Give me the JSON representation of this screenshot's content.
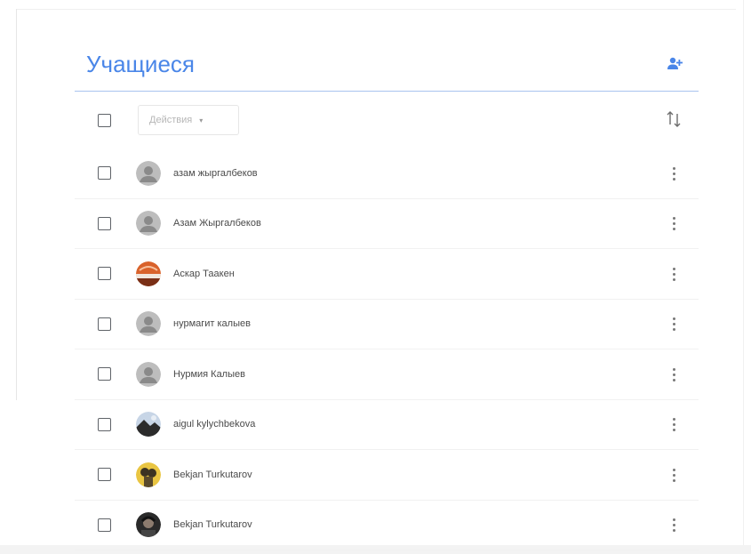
{
  "header": {
    "title": "Учащиеся"
  },
  "toolbar": {
    "actions_label": "Действия",
    "actions_caret": "▾"
  },
  "students": [
    {
      "name": "азам жыргалбеков",
      "avatar": "default"
    },
    {
      "name": "Азам Жыргалбеков",
      "avatar": "default"
    },
    {
      "name": "Аскар Таакен",
      "avatar": "photo-orange"
    },
    {
      "name": "нурмагит калыев",
      "avatar": "default"
    },
    {
      "name": "Нурмия Калыев",
      "avatar": "default"
    },
    {
      "name": "aigul kylychbekova",
      "avatar": "photo-landscape"
    },
    {
      "name": "Bekjan Turkutarov",
      "avatar": "photo-yellow"
    },
    {
      "name": "Bekjan Turkutarov",
      "avatar": "photo-dark"
    }
  ],
  "colors": {
    "accent": "#4a86e8",
    "divider": "#a9c4ef",
    "icon": "#5f6368"
  },
  "icons": {
    "add_person": "person-add-icon",
    "sort": "sort-icon",
    "more": "more-vert-icon"
  }
}
